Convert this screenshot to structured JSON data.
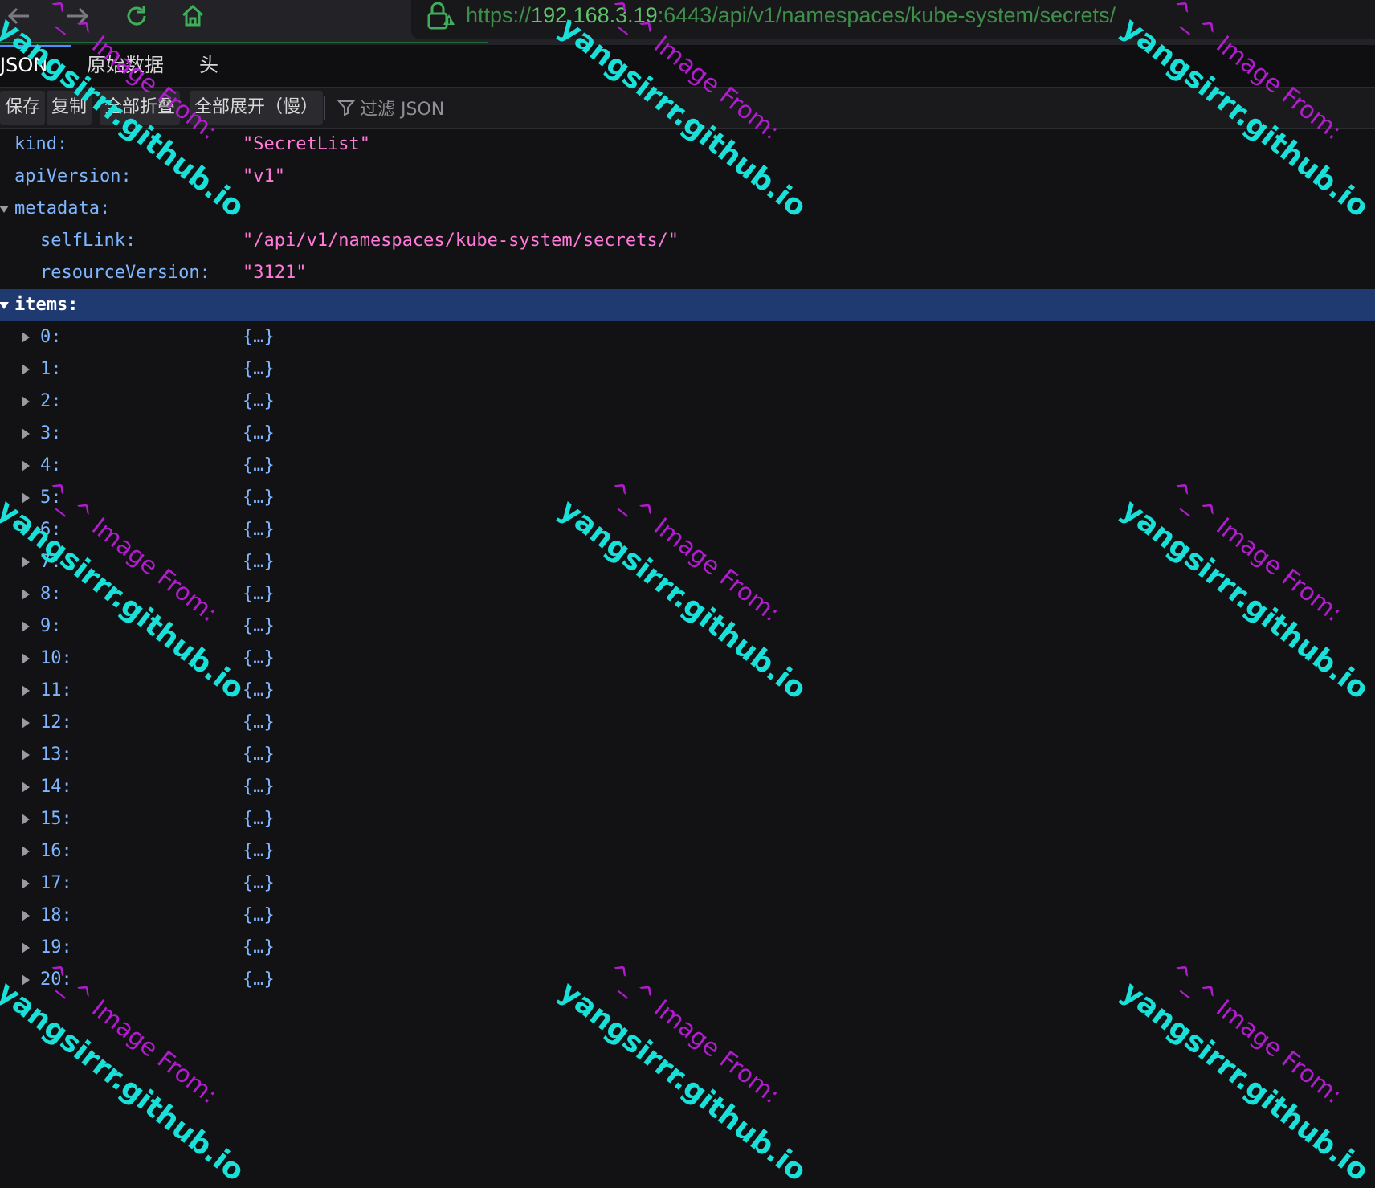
{
  "browser": {
    "url_prefix": "https://",
    "url_host": "192.168.3.19",
    "url_rest": ":6443/api/v1/namespaces/kube-system/secrets/"
  },
  "tabs": [
    {
      "label": "JSON",
      "active": true
    },
    {
      "label": "原始数据",
      "active": false
    },
    {
      "label": "头",
      "active": false
    }
  ],
  "toolbar": {
    "save_label": "保存",
    "copy_label": "复制",
    "collapse_all_label": "全部折叠",
    "expand_all_label": "全部展开（慢）",
    "filter_placeholder": "过滤 JSON"
  },
  "json": {
    "kind_key": "kind:",
    "kind_value": "\"SecretList\"",
    "apiversion_key": "apiVersion:",
    "apiversion_value": "\"v1\"",
    "metadata_key": "metadata:",
    "selflink_key": "selfLink:",
    "selflink_value": "\"/api/v1/namespaces/kube-system/secrets/\"",
    "resourceversion_key": "resourceVersion:",
    "resourceversion_value": "\"3121\"",
    "items_key": "items:",
    "item_keys": [
      "0:",
      "1:",
      "2:",
      "3:",
      "4:",
      "5:",
      "6:",
      "7:",
      "8:",
      "9:",
      "10:",
      "11:",
      "12:",
      "13:",
      "14:",
      "15:",
      "16:",
      "17:",
      "18:",
      "19:",
      "20:"
    ],
    "collapsed_value": "{…}"
  },
  "watermark": {
    "line1": "^_^ Image From:",
    "line2": "yangsirrr.github.io"
  },
  "colors": {
    "key": "#7fb6ff",
    "string": "#ff7ad9",
    "selected_row": "#1f3a70",
    "watermark_line1": "#b21ccf",
    "watermark_line2": "#19e0d8"
  }
}
